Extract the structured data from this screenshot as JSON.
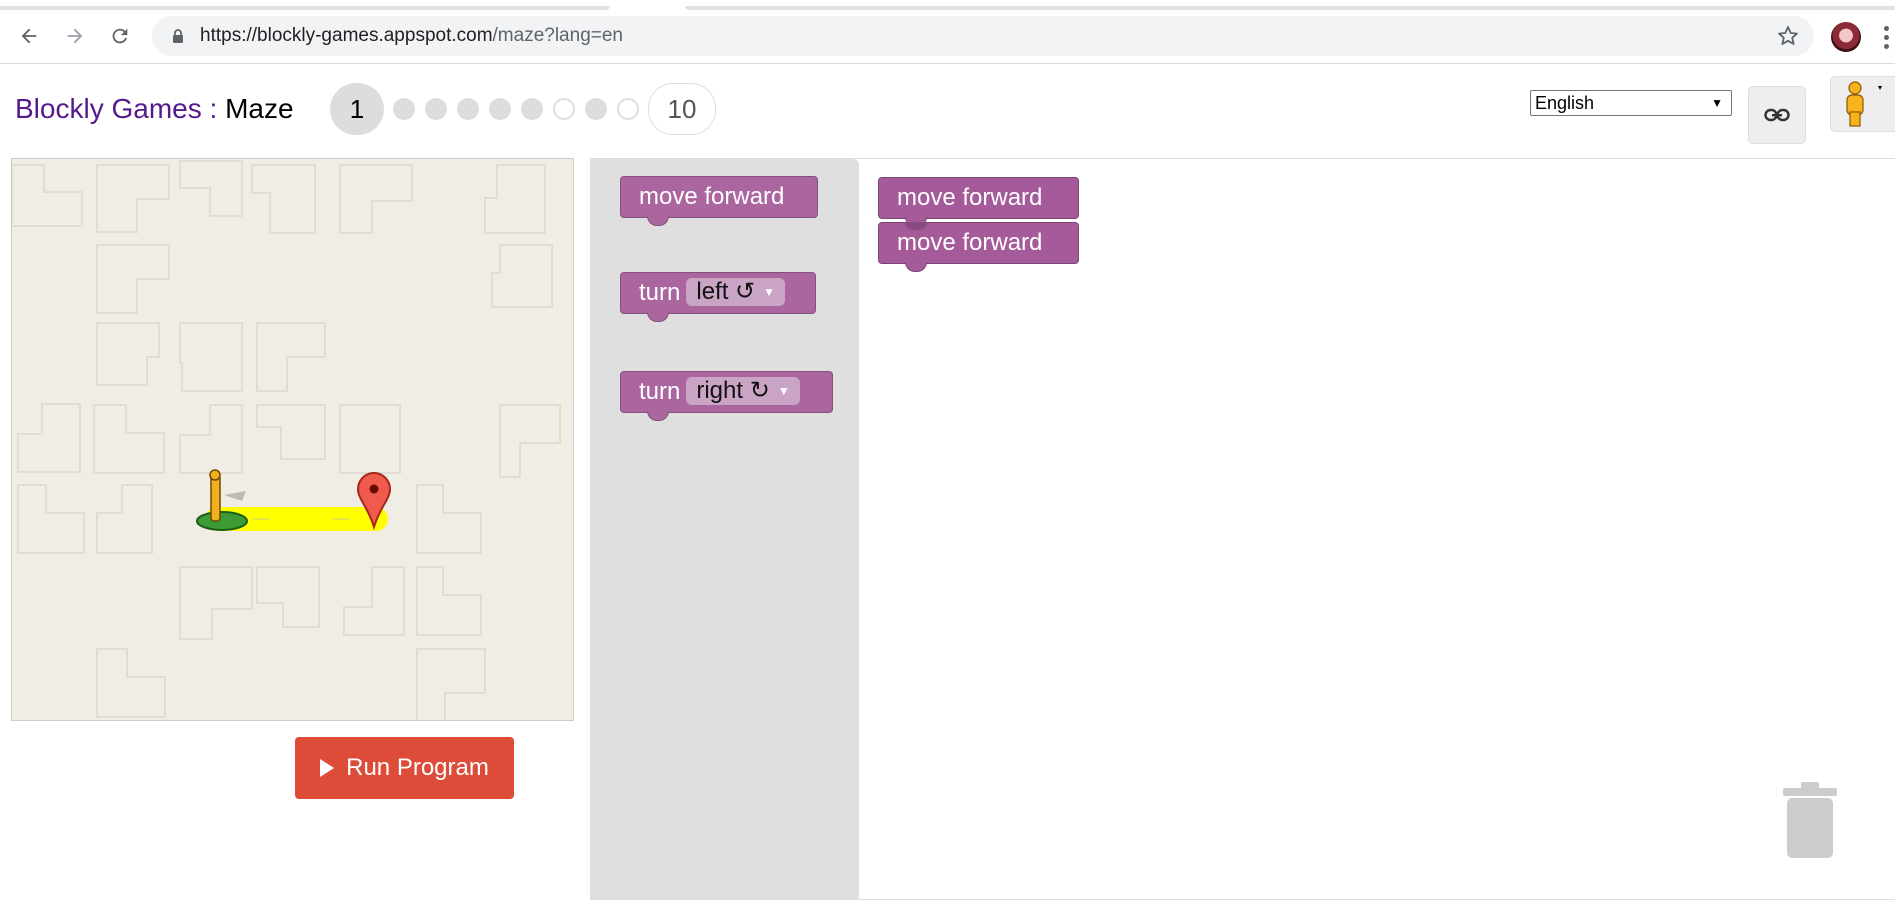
{
  "browser": {
    "url_main": "https://blockly-games.appspot.com",
    "url_path": "/maze?lang=en",
    "back_icon": "arrow-left-icon",
    "forward_icon": "arrow-right-icon",
    "reload_icon": "reload-icon",
    "bookmark_icon": "star-icon"
  },
  "header": {
    "brand": "Blockly Games",
    "separator": " : ",
    "game": "Maze",
    "current_level": "1",
    "last_level": "10",
    "levels_done": [
      true,
      true,
      true,
      true,
      true,
      false,
      true,
      false
    ],
    "language": "English",
    "link_icon": "link-icon",
    "pegman_icon": "pegman-icon"
  },
  "maze": {
    "run_label": "Run Program",
    "start_icon": "start-marker-icon",
    "finish_icon": "finish-marker-icon"
  },
  "toolbox": {
    "move_forward": "move forward",
    "turn_label": "turn",
    "left_option": "left ↺",
    "right_option": "right ↻"
  },
  "workspace": {
    "blocks": [
      "move forward",
      "move forward"
    ]
  },
  "colors": {
    "block": "#a55b99",
    "run_button": "#dd4b39",
    "path": "#ffff00",
    "brand_link": "#551a8b"
  }
}
